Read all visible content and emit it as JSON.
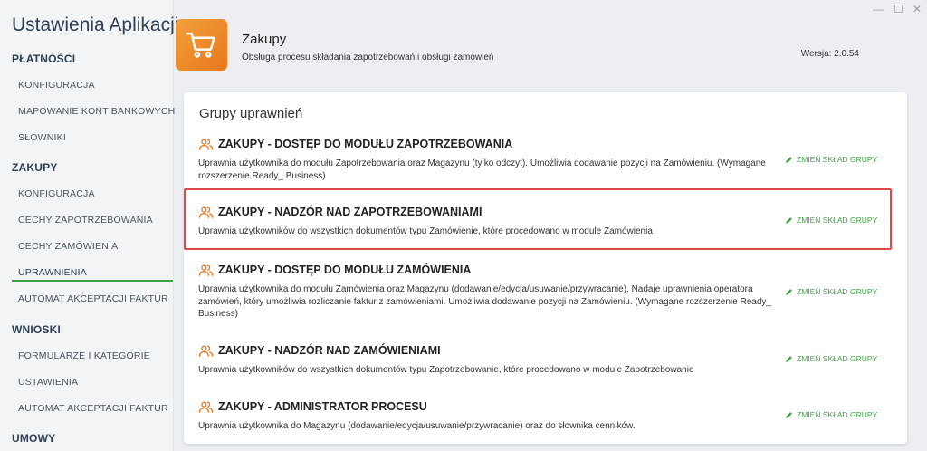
{
  "app": {
    "title": "Ustawienia Aplikacji"
  },
  "window_controls": {
    "minimize": "—",
    "maximize": "☐",
    "close": "✕"
  },
  "sidebar": {
    "sections": [
      {
        "label": "PŁATNOŚCI",
        "items": [
          "KONFIGURACJA",
          "MAPOWANIE KONT BANKOWYCH",
          "SŁOWNIKI"
        ]
      },
      {
        "label": "ZAKUPY",
        "items": [
          "KONFIGURACJA",
          "CECHY ZAPOTRZEBOWANIA",
          "CECHY ZAMÓWIENIA",
          "UPRAWNIENIA",
          "AUTOMAT AKCEPTACJI FAKTUR"
        ]
      },
      {
        "label": "WNIOSKI",
        "items": [
          "FORMULARZE I KATEGORIE",
          "USTAWIENIA",
          "AUTOMAT AKCEPTACJI FAKTUR"
        ]
      },
      {
        "label": "UMOWY",
        "items": []
      }
    ],
    "active_item": "UPRAWNIENIA"
  },
  "header": {
    "title": "Zakupy",
    "description": "Obsługa procesu składania zapotrzebowań i obsługi zamówień",
    "version": "Wersja: 2.0.54"
  },
  "card": {
    "title": "Grupy uprawnień",
    "edit_label": "ZMIEŃ SKŁAD GRUPY",
    "groups": [
      {
        "name": "ZAKUPY - DOSTĘP DO MODUŁU ZAPOTRZEBOWANIA",
        "description": "Uprawnia użytkownika do modułu Zapotrzebowania oraz Magazynu (tylko odczyt). Umożliwia dodawanie pozycji na Zamówieniu. (Wymagane rozszerzenie Ready_ Business)"
      },
      {
        "name": "ZAKUPY - NADZÓR NAD ZAPOTRZEBOWANIAMI",
        "description": "Uprawnia użytkowników do wszystkich dokumentów typu Zamówienie, które procedowano w module Zamówienia"
      },
      {
        "name": "ZAKUPY - DOSTĘP DO MODUŁU ZAMÓWIENIA",
        "description": "Uprawnia użytkownika do modułu Zamówienia oraz Magazynu (dodawanie/edycja/usuwanie/przywracanie). Nadaje uprawnienia operatora zamówień, który umożliwia rozliczanie faktur z zamówieniami. Umożliwia dodawanie pozycji na Zamówieniu. (Wymagane rozszerzenie Ready_ Business)"
      },
      {
        "name": "ZAKUPY - NADZÓR NAD ZAMÓWIENIAMI",
        "description": "Uprawnia użytkowników do wszystkich dokumentów typu Zapotrzebowanie, które procedowano w module Zapotrzebowanie"
      },
      {
        "name": "ZAKUPY - ADMINISTRATOR PROCESU",
        "description": "Uprawnia użytkownika do Magazynu (dodawanie/edycja/usuwanie/przywracanie) oraz do słownika cenników."
      }
    ]
  },
  "colors": {
    "accent": "#43a047",
    "highlight": "#e04a4a",
    "brand": "#e8771e"
  }
}
